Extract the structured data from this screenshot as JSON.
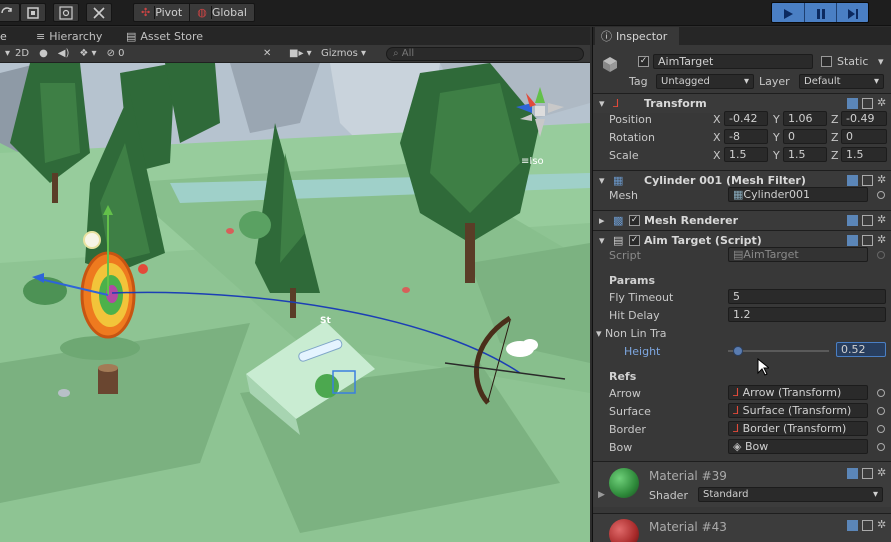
{
  "toolbar": {
    "pivot_label": "Pivot",
    "global_label": "Global"
  },
  "tabs": {
    "hierarchy": "Hierarchy",
    "asset_store": "Asset Store",
    "inspector": "Inspector"
  },
  "scene_toolbar": {
    "mode_2d": "2D",
    "fx_count": "0",
    "gizmos_label": "Gizmos",
    "search_placeholder": "All",
    "iso_label": "Iso"
  },
  "scene_world": {
    "panel_button_label": "St"
  },
  "inspector": {
    "object_name": "AimTarget",
    "static_label": "Static",
    "tag_label": "Tag",
    "tag_value": "Untagged",
    "layer_label": "Layer",
    "layer_value": "Default",
    "transform": {
      "title": "Transform",
      "position_label": "Position",
      "rotation_label": "Rotation",
      "scale_label": "Scale",
      "position": {
        "x": "-0.42",
        "y": "1.06",
        "z": "-0.49"
      },
      "rotation": {
        "x": "-8",
        "y": "0",
        "z": "0"
      },
      "scale": {
        "x": "1.5",
        "y": "1.5",
        "z": "1.5"
      }
    },
    "mesh_filter": {
      "title": "Cylinder 001 (Mesh Filter)",
      "mesh_label": "Mesh",
      "mesh_value": "Cylinder001"
    },
    "mesh_renderer": {
      "title": "Mesh Renderer"
    },
    "aim_target": {
      "title": "Aim Target (Script)",
      "script_label": "Script",
      "script_value": "AimTarget",
      "params_header": "Params",
      "fly_timeout_label": "Fly Timeout",
      "fly_timeout_value": "5",
      "hit_delay_label": "Hit Delay",
      "hit_delay_value": "1.2",
      "non_lin_tra_label": "Non Lin Tra",
      "height_label": "Height",
      "height_value": "0.52",
      "height_slider_fraction": 0.05,
      "refs_header": "Refs",
      "arrow_label": "Arrow",
      "arrow_value": "Arrow (Transform)",
      "surface_label": "Surface",
      "surface_value": "Surface (Transform)",
      "border_label": "Border",
      "border_value": "Border (Transform)",
      "bow_label": "Bow",
      "bow_value": "Bow"
    },
    "materials": [
      {
        "name": "Material #39",
        "shader_label": "Shader",
        "shader_value": "Standard",
        "color": "#2e8a3a"
      },
      {
        "name": "Material #43",
        "color": "#a82a2a"
      }
    ]
  },
  "colors": {
    "ground": "#8fc895",
    "accent_blue": "#4a7fc4",
    "highlight_field": "#283e5e"
  }
}
